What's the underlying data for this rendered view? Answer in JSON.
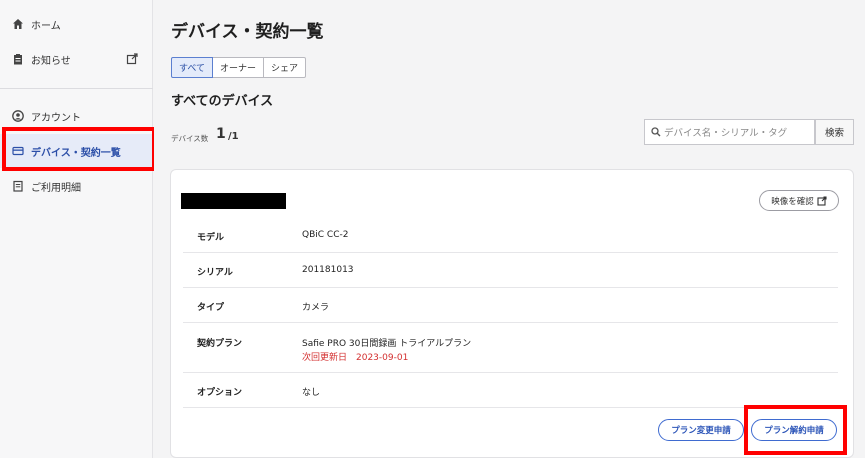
{
  "sidebar": {
    "items": [
      {
        "label": "ホーム",
        "icon": "home-icon"
      },
      {
        "label": "お知らせ",
        "icon": "notice-icon"
      },
      {
        "label": "アカウント",
        "icon": "account-icon"
      },
      {
        "label": "デバイス・契約一覧",
        "icon": "device-list-icon"
      },
      {
        "label": "ご利用明細",
        "icon": "statement-icon"
      }
    ]
  },
  "page": {
    "title": "デバイス・契約一覧",
    "tabs": [
      "すべて",
      "オーナー",
      "シェア"
    ],
    "section_title": "すべてのデバイス",
    "count_label": "デバイス数",
    "count_value": "1",
    "count_total": "/1",
    "search_placeholder": "デバイス名・シリアル・タグ",
    "search_button": "検索"
  },
  "device": {
    "video_button": "映像を確認",
    "rows": [
      {
        "key": "モデル",
        "value": "QBiC CC-2"
      },
      {
        "key": "シリアル",
        "value": "201181013"
      },
      {
        "key": "タイプ",
        "value": "カメラ"
      },
      {
        "key": "契約プラン",
        "value": "Safie PRO 30日間録画 トライアルプラン",
        "sub": "次回更新日　2023-09-01"
      },
      {
        "key": "オプション",
        "value": "なし"
      }
    ],
    "plan_change_button": "プラン変更申請",
    "plan_cancel_button": "プラン解約申請"
  },
  "colors": {
    "accent": "#2c55b8",
    "highlight": "#ff0000",
    "renewal": "#d32f2f"
  }
}
